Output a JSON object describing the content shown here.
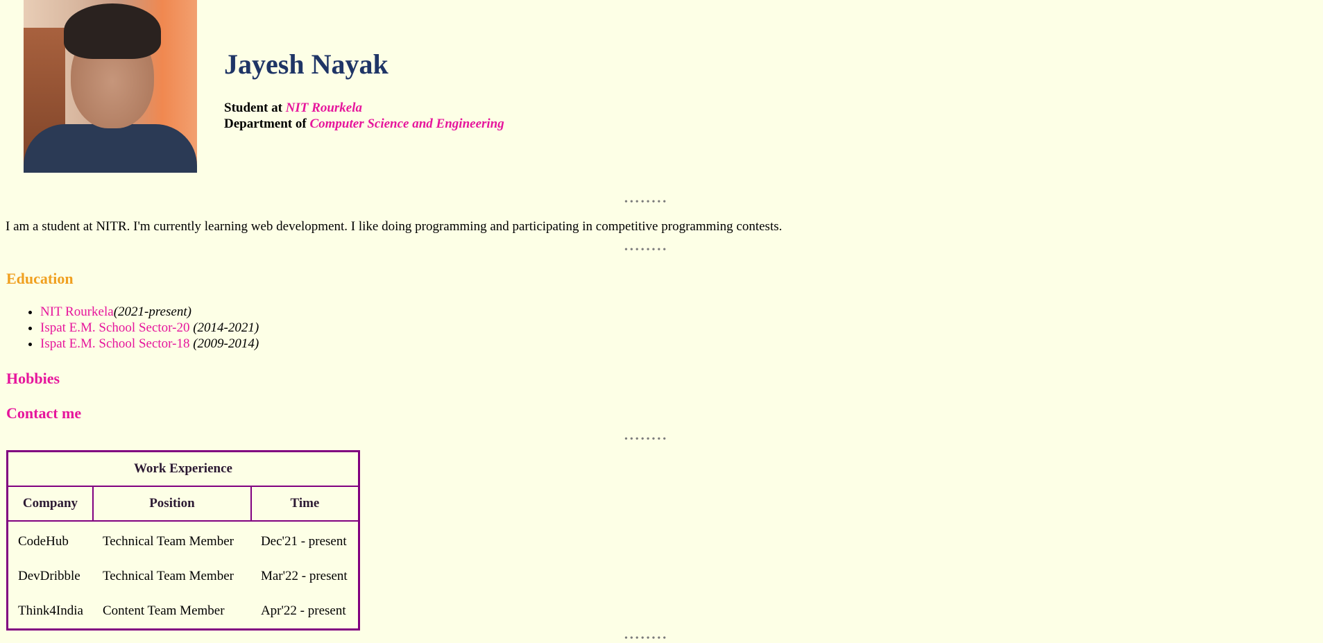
{
  "profile": {
    "name": "Jayesh Nayak",
    "student_prefix": "Student at ",
    "institute": "NIT Rourkela",
    "department_prefix": "Department of ",
    "department": "Computer Science and Engineering"
  },
  "separator": "••••••••",
  "about": "I am a student at NITR. I'm currently learning web development. I like doing programming and participating in competitive programming contests.",
  "education": {
    "heading": "Education",
    "items": [
      {
        "school": "NIT Rourkela",
        "years": "(2021-present)"
      },
      {
        "school": "Ispat E.M. School Sector-20",
        "years": "(2014-2021)"
      },
      {
        "school": "Ispat E.M. School Sector-18",
        "years": "(2009-2014)"
      }
    ]
  },
  "hobbies": {
    "heading": "Hobbies"
  },
  "contact": {
    "heading": "Contact me"
  },
  "work": {
    "caption": "Work Experience",
    "headers": [
      "Company",
      "Position",
      "Time"
    ],
    "rows": [
      [
        "CodeHub",
        "Technical Team Member",
        "Dec'21 - present"
      ],
      [
        "DevDribble",
        "Technical Team Member",
        "Mar'22 - present"
      ],
      [
        "Think4India",
        "Content Team Member",
        "Apr'22 - present"
      ]
    ]
  },
  "colors": {
    "background": "#fdffe6",
    "name": "#1f3566",
    "accent_pink": "#e6159c",
    "education_heading": "#f0a020",
    "table_border": "#800080"
  }
}
